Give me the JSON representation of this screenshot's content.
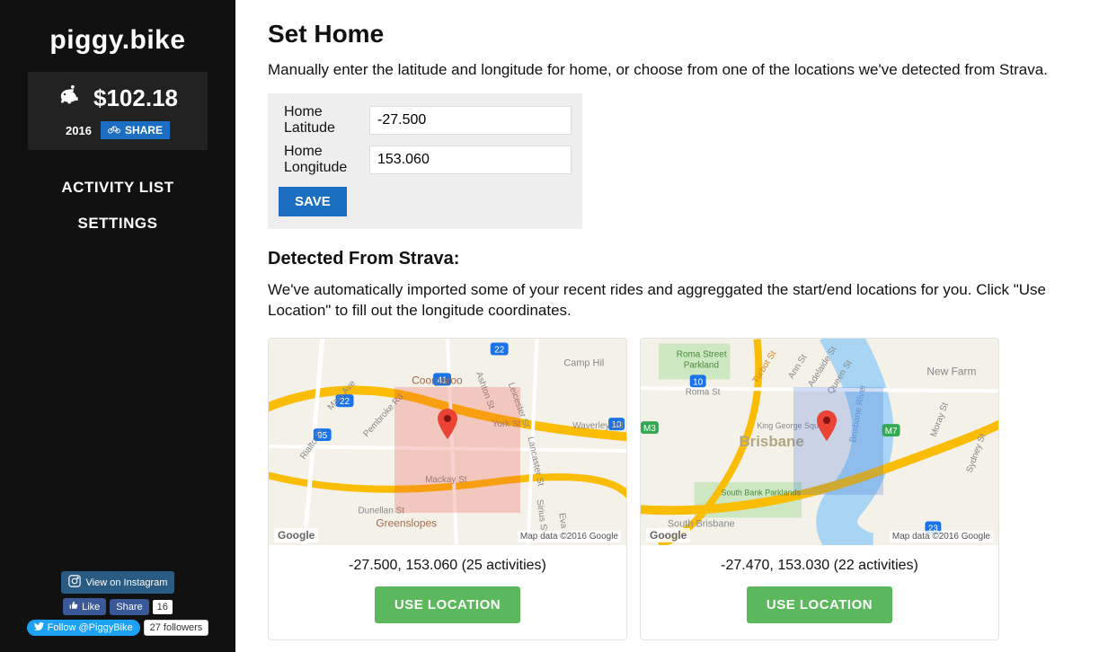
{
  "sidebar": {
    "brand": "piggy.bike",
    "balance": "$102.18",
    "year": "2016",
    "share_label": "SHARE",
    "nav": {
      "activity": "ACTIVITY LIST",
      "settings": "SETTINGS"
    },
    "social": {
      "instagram": "View on Instagram",
      "fb_like": "Like",
      "fb_share": "Share",
      "fb_count": "16",
      "tw_follow": "Follow @PiggyBike",
      "tw_followers": "27 followers"
    }
  },
  "main": {
    "title": "Set Home",
    "instruction": "Manually enter the latitude and longitude for home, or choose from one of the locations we've detected from Strava.",
    "form": {
      "lat_label": "Home Latitude",
      "lat_value": "-27.500",
      "lon_label": "Home Longitude",
      "lon_value": "153.060",
      "save_label": "SAVE"
    },
    "detected": {
      "title": "Detected From Strava:",
      "desc": "We've automatically imported some of your recent rides and aggreggated the start/end locations for you. Click \"Use Location\" to fill out the longitude coordinates.",
      "use_label": "USE LOCATION",
      "map_attr": "Map data ©2016 Google",
      "map_logo": "Google",
      "locations": [
        {
          "coords": "-27.500, 153.060 (25 activities)"
        },
        {
          "coords": "-27.470, 153.030 (22 activities)"
        }
      ]
    }
  }
}
